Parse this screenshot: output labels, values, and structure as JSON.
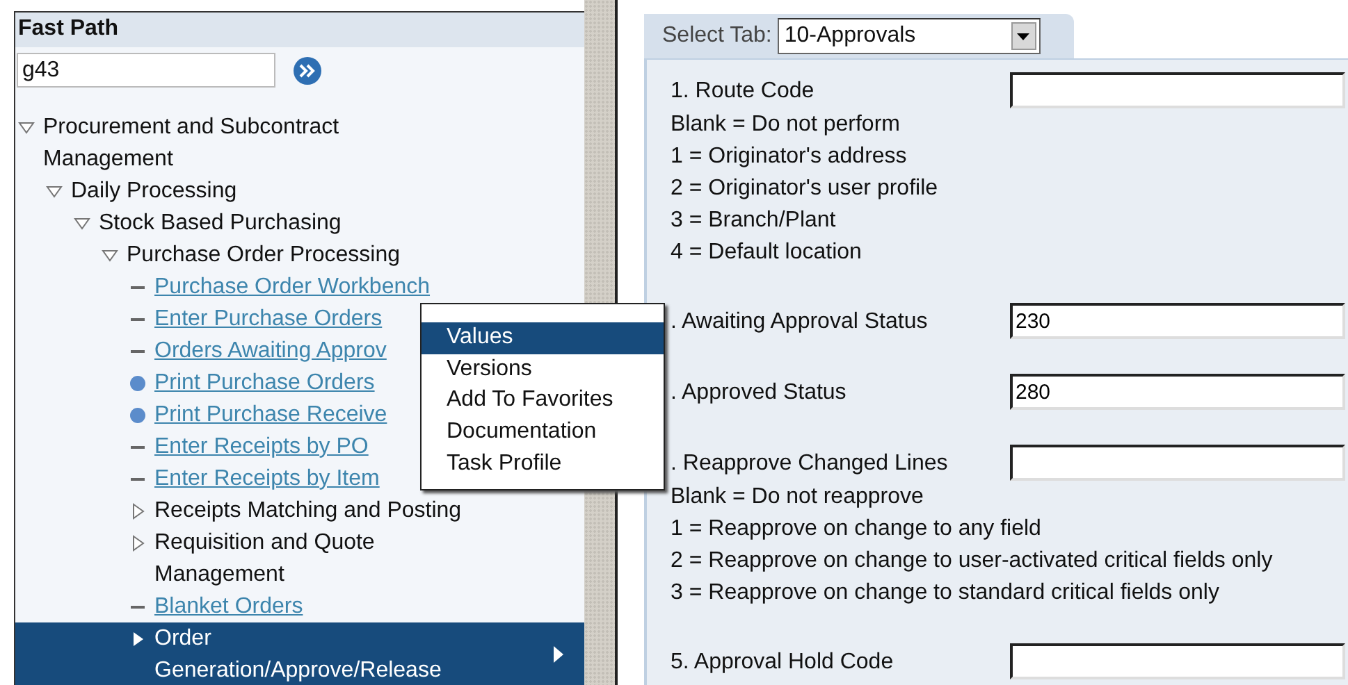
{
  "sidebar": {
    "title": "Fast Path",
    "fast_path": {
      "value": "g43"
    },
    "tree": [
      {
        "label": "Procurement and Subcontract Management",
        "kind": "folder",
        "expanded": true,
        "selected": false,
        "children": [
          {
            "label": "Daily Processing",
            "kind": "folder",
            "expanded": true,
            "selected": false,
            "children": [
              {
                "label": "Stock Based Purchasing",
                "kind": "folder",
                "expanded": true,
                "selected": false,
                "children": [
                  {
                    "label": "Purchase Order Processing",
                    "kind": "folder",
                    "expanded": true,
                    "selected": false,
                    "children": [
                      {
                        "label": "Purchase Order Workbench",
                        "kind": "task",
                        "selected": false
                      },
                      {
                        "label": "Enter Purchase Orders",
                        "kind": "task",
                        "selected": false
                      },
                      {
                        "label": "Orders Awaiting Approv",
                        "kind": "task",
                        "selected": false
                      },
                      {
                        "label": "Print Purchase Orders",
                        "kind": "report",
                        "selected": false
                      },
                      {
                        "label": "Print Purchase Receive",
                        "kind": "report",
                        "selected": false
                      },
                      {
                        "label": "Enter Receipts by PO",
                        "kind": "task",
                        "selected": false
                      },
                      {
                        "label": "Enter Receipts by Item",
                        "kind": "task",
                        "selected": false
                      },
                      {
                        "label": "Receipts Matching and Posting",
                        "kind": "folder",
                        "expanded": false,
                        "selected": false
                      },
                      {
                        "label": "Requisition and Quote Management",
                        "kind": "folder",
                        "expanded": false,
                        "selected": false
                      },
                      {
                        "label": "Blanket Orders",
                        "kind": "task",
                        "selected": false
                      },
                      {
                        "label": "Order Generation/Approve/Release",
                        "kind": "folder",
                        "expanded": false,
                        "selected": true
                      }
                    ]
                  }
                ]
              }
            ]
          }
        ]
      }
    ]
  },
  "context_menu": {
    "items": [
      {
        "label": "Values",
        "selected": true
      },
      {
        "label": "Versions",
        "selected": false
      },
      {
        "label": "Add To Favorites",
        "selected": false
      },
      {
        "label": "Documentation",
        "selected": false
      },
      {
        "label": "Task Profile",
        "selected": false
      }
    ]
  },
  "form": {
    "tab_label": "Select Tab:",
    "tab_select": {
      "value": "10-Approvals"
    },
    "fields": [
      {
        "label": "1. Route Code",
        "hints": [
          "Blank = Do not perform",
          "1 = Originator's address",
          "2 = Originator's user profile",
          "3 = Branch/Plant",
          "4 = Default location"
        ]
      },
      {
        "label": ". Awaiting Approval Status",
        "value": "230"
      },
      {
        "label": ". Approved Status",
        "value": "280"
      },
      {
        "label": ". Reapprove Changed Lines",
        "hints": [
          "Blank = Do not reapprove",
          "1 = Reapprove on change to any field",
          "2 = Reapprove on change to user-activated critical fields only",
          "3 = Reapprove on change to standard critical fields only"
        ]
      },
      {
        "label": "5. Approval Hold Code"
      }
    ]
  }
}
